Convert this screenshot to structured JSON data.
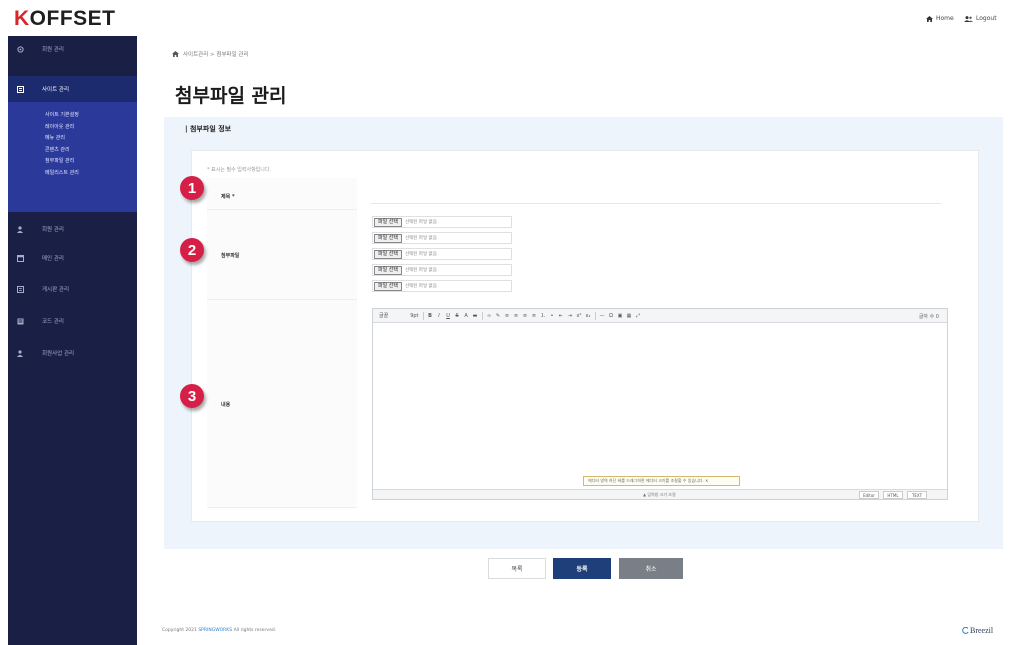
{
  "app": {
    "logo_k": "K",
    "logo_rest": "OFFSET",
    "home_label": "Home",
    "logout_label": "Logout"
  },
  "sidebar": {
    "items": [
      {
        "label": "회원 관리",
        "icon": "settings-icon"
      },
      {
        "label": "사이트 관리",
        "icon": "document-icon",
        "active": true
      },
      {
        "label": "회원 관리",
        "icon": "person-icon"
      },
      {
        "label": "메인 관리",
        "icon": "window-icon"
      },
      {
        "label": "게시판 관리",
        "icon": "board-icon"
      },
      {
        "label": "코드 관리",
        "icon": "grid-icon"
      },
      {
        "label": "회원사업 관리",
        "icon": "person-icon"
      }
    ],
    "submenu": [
      "사이트 기본설정",
      "레이아웃 관리",
      "메뉴 관리",
      "콘텐츠 관리",
      "첨부파일 관리",
      "메일리스트 관리"
    ]
  },
  "breadcrumb": {
    "text": "사이트관리 > 첨부파일 관리"
  },
  "page": {
    "title": "첨부파일 관리"
  },
  "section": {
    "title": "| 첨부파일 정보"
  },
  "form": {
    "required_note": "* 표시는 필수 입력사항입니다.",
    "fields": {
      "title_label": "제목 *",
      "title_value": "",
      "attachment_label": "첨부파일",
      "content_label": "내용"
    },
    "files": [
      {
        "button": "파일 선택",
        "status": "선택된 파일 없음"
      },
      {
        "button": "파일 선택",
        "status": "선택된 파일 없음"
      },
      {
        "button": "파일 선택",
        "status": "선택된 파일 없음"
      },
      {
        "button": "파일 선택",
        "status": "선택된 파일 없음"
      },
      {
        "button": "파일 선택",
        "status": "선택된 파일 없음"
      }
    ],
    "badges": [
      "1",
      "2",
      "3"
    ],
    "badge_color": "#d61f47"
  },
  "editor": {
    "font_select": "글꼴",
    "size_select": "9pt",
    "counter": "글자 수 0",
    "notice": "에디터 영역 하단 바를 드래그하면 에디터 크기를 조절할 수 있습니다. ✕",
    "resize_label": "▲ 입력창 크기 조절",
    "modes": [
      "Editor",
      "HTML",
      "TEXT"
    ]
  },
  "buttons": {
    "list": "목록",
    "register": "등록",
    "cancel": "취소"
  },
  "footer": {
    "copyright_prefix": "Copyright 2021",
    "brand": "SPRINGWORKS",
    "copyright_suffix": "All rights reserved.",
    "vendor": "Breezil"
  },
  "colors": {
    "sidebar_bg": "#1a1f46",
    "sidebar_active": "#1c2a6e",
    "submenu_bg": "#2b3a9a",
    "register_btn": "#1e3f7a",
    "cancel_btn": "#7a7f87",
    "logo_accent": "#d7262e"
  }
}
